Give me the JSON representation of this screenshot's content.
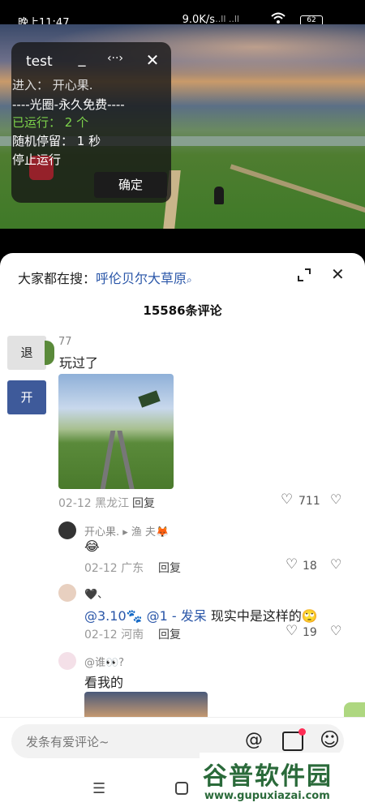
{
  "status_bar": {
    "time": "晚上11:47",
    "network": "9.0K/s",
    "signal": "..ll ..ll",
    "wifi_icon": "wifi-icon",
    "battery": "62"
  },
  "float_window": {
    "title": "test",
    "minimize": "_",
    "move": "‹··›",
    "close": "✕",
    "lines": [
      "进入：  开心果.",
      "----光圈-永久免费----",
      "已运行：  2 个",
      "随机停留：  1 秒",
      "停止运行"
    ],
    "ok_label": "确定"
  },
  "comments_panel": {
    "search_prefix": "大家都在搜：",
    "search_keyword": "呼伦贝尔大草原",
    "search_icon": "⌕",
    "expand_icon": "⤢",
    "close_icon": "✕",
    "count": "15586条评论"
  },
  "side_buttons": {
    "exit": "退",
    "open": "开"
  },
  "comments": [
    {
      "user": "77",
      "text": "玩过了",
      "date_location": "02-12 黑龙江",
      "reply": "回复",
      "likes": "711"
    },
    {
      "user": "开心果. ▸ 渔 夫🦊",
      "text": "😂",
      "date_location": "02-12 广东",
      "reply": "回复",
      "likes": "18"
    },
    {
      "user": "🖤、",
      "text_mention": "@3.10🐾 @1 - 发呆",
      "text": " 现实中是这样的🙄",
      "date_location": "02-12 河南",
      "reply": "回复",
      "likes": "19"
    },
    {
      "user": "@谁👀?",
      "text": "看我的"
    }
  ],
  "input_bar": {
    "placeholder": "发条有爱评论~",
    "at_icon": "@",
    "image_icon": "image-icon",
    "emoji_icon": "☺"
  },
  "nav_bar": {
    "menu": "☰",
    "home": "home-icon",
    "back": "‹"
  },
  "watermark": {
    "cn": "谷普软件园",
    "url": "www.gupuxiazai.com"
  }
}
